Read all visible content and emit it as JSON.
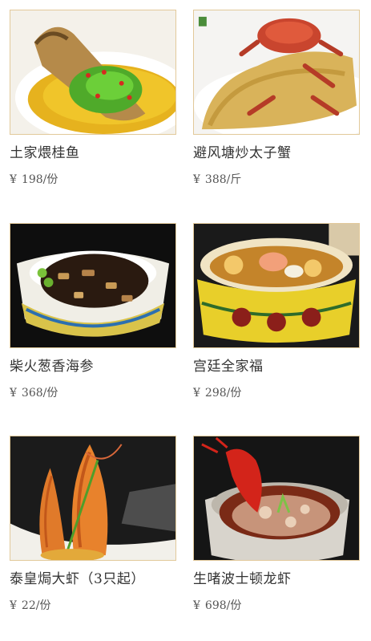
{
  "currency_symbol": "¥",
  "dishes": [
    {
      "name": "土家煨桂鱼",
      "price": "198/份",
      "image": "braised-mandarin-fish-photo"
    },
    {
      "name": "避风塘炒太子蟹",
      "price": "388/斤",
      "image": "typhoon-shelter-crab-photo"
    },
    {
      "name": "柴火葱香海参",
      "price": "368/份",
      "image": "scallion-sea-cucumber-photo"
    },
    {
      "name": "宫廷全家福",
      "price": "298/份",
      "image": "imperial-family-soup-photo"
    },
    {
      "name": "泰皇焗大虾（3只起）",
      "price": "22/份",
      "image": "baked-prawns-photo"
    },
    {
      "name": "生啫波士顿龙虾",
      "price": "698/份",
      "image": "boston-lobster-claypot-photo"
    }
  ]
}
